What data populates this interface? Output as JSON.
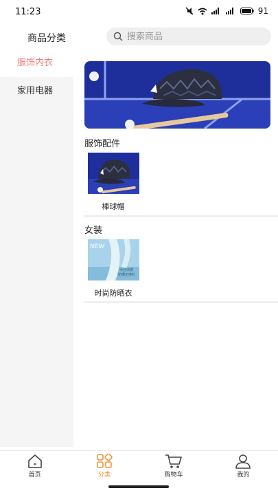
{
  "status": {
    "time": "11:23",
    "battery": "91"
  },
  "header": {
    "title": "商品分类",
    "search_placeholder": "搜索商品"
  },
  "sidebar": {
    "items": [
      {
        "label": "服饰内衣",
        "active": true
      },
      {
        "label": "家用电器",
        "active": false
      }
    ]
  },
  "sections": [
    {
      "title": "服饰配件",
      "products": [
        {
          "name": "棒球帽"
        }
      ]
    },
    {
      "title": "女装",
      "products": [
        {
          "name": "时尚防晒衣",
          "image_text": [
            "NEW",
            "冰丝凉感",
            "防晒无感衫"
          ]
        }
      ]
    }
  ],
  "tabbar": {
    "items": [
      {
        "label": "首页",
        "icon": "home-icon",
        "active": false
      },
      {
        "label": "分类",
        "icon": "category-icon",
        "active": true
      },
      {
        "label": "购物车",
        "icon": "cart-icon",
        "active": false
      },
      {
        "label": "我的",
        "icon": "user-icon",
        "active": false
      }
    ]
  },
  "colors": {
    "accent_sidebar": "#f0827f",
    "accent_tab": "#f39135"
  }
}
